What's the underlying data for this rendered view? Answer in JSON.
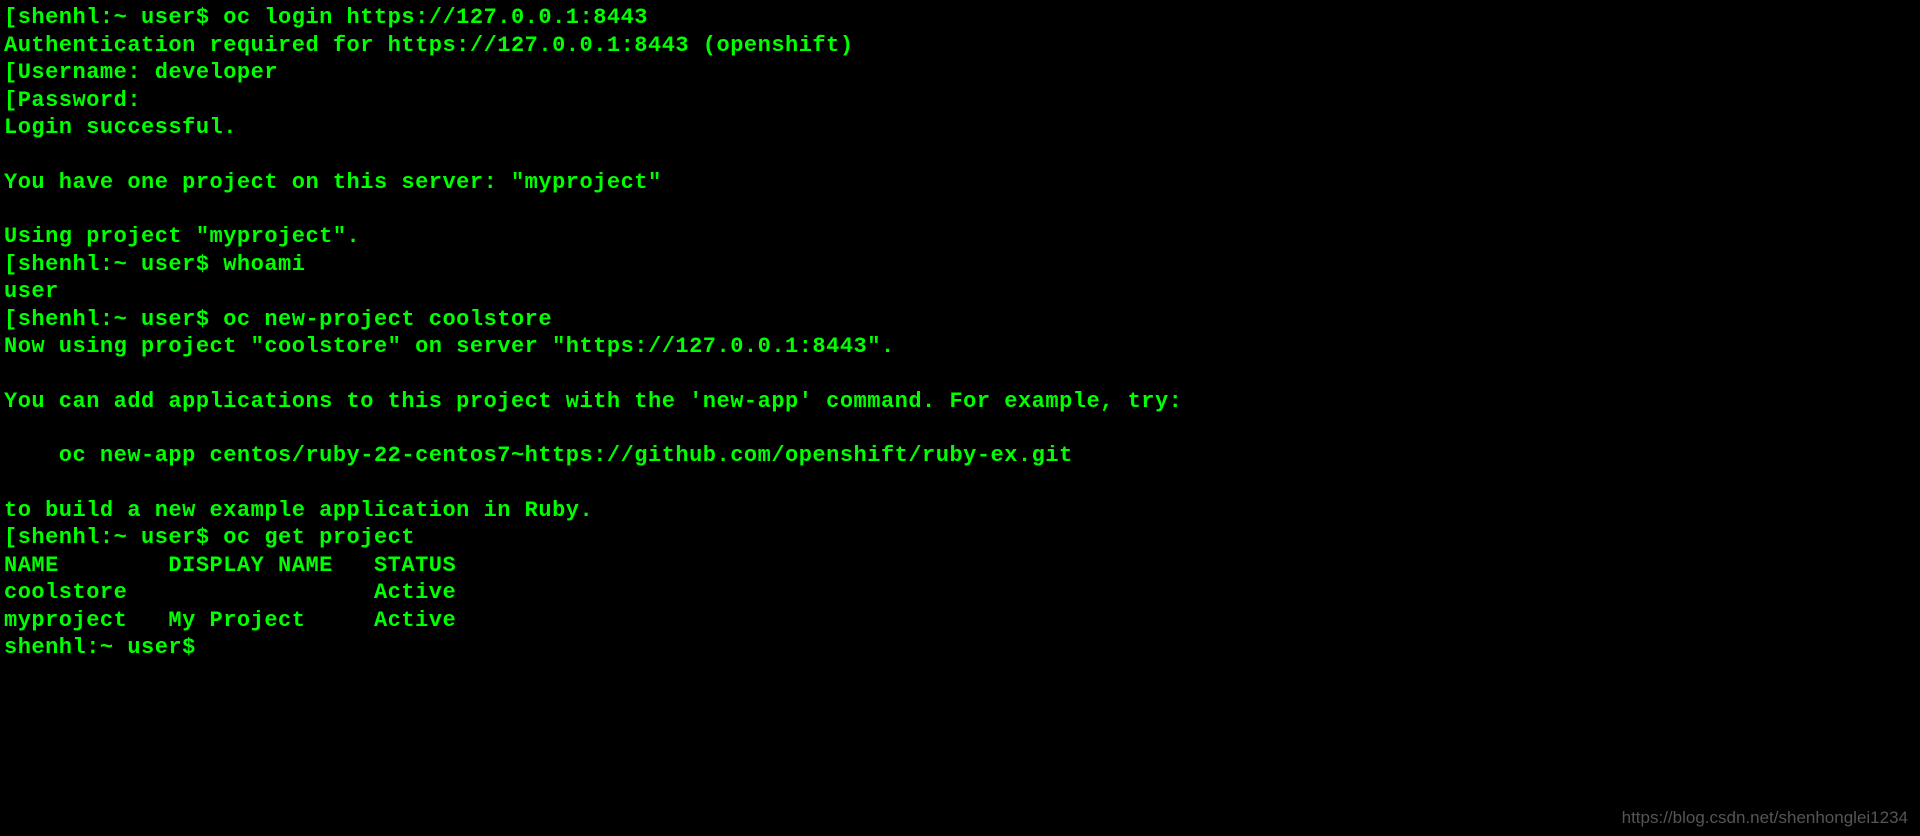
{
  "terminal": {
    "lines": [
      {
        "type": "prompt-cmd",
        "prompt": "shenhl:~ user$",
        "cmd": " oc login https://127.0.0.1:8443",
        "bracket": true
      },
      {
        "type": "output",
        "text": "Authentication required for https://127.0.0.1:8443 (openshift)"
      },
      {
        "type": "prompt-cmd",
        "prompt": "Username:",
        "cmd": " developer",
        "bracket": true
      },
      {
        "type": "prompt-cmd",
        "prompt": "Password:",
        "cmd": "",
        "bracket": true
      },
      {
        "type": "output",
        "text": "Login successful."
      },
      {
        "type": "blank"
      },
      {
        "type": "output",
        "text": "You have one project on this server: \"myproject\""
      },
      {
        "type": "blank"
      },
      {
        "type": "output",
        "text": "Using project \"myproject\"."
      },
      {
        "type": "prompt-cmd",
        "prompt": "shenhl:~ user$",
        "cmd": " whoami",
        "bracket": true
      },
      {
        "type": "output",
        "text": "user"
      },
      {
        "type": "prompt-cmd",
        "prompt": "shenhl:~ user$",
        "cmd": " oc new-project coolstore",
        "bracket": true
      },
      {
        "type": "output",
        "text": "Now using project \"coolstore\" on server \"https://127.0.0.1:8443\"."
      },
      {
        "type": "blank"
      },
      {
        "type": "output",
        "text": "You can add applications to this project with the 'new-app' command. For example, try:"
      },
      {
        "type": "blank"
      },
      {
        "type": "output",
        "text": "    oc new-app centos/ruby-22-centos7~https://github.com/openshift/ruby-ex.git"
      },
      {
        "type": "blank"
      },
      {
        "type": "output",
        "text": "to build a new example application in Ruby."
      },
      {
        "type": "prompt-cmd",
        "prompt": "shenhl:~ user$",
        "cmd": " oc get project",
        "bracket": true
      },
      {
        "type": "output",
        "text": "NAME        DISPLAY NAME   STATUS"
      },
      {
        "type": "output",
        "text": "coolstore                  Active"
      },
      {
        "type": "output",
        "text": "myproject   My Project     Active"
      },
      {
        "type": "prompt-cmd",
        "prompt": "shenhl:~ user$",
        "cmd": "",
        "bracket": false
      }
    ]
  },
  "watermark": "https://blog.csdn.net/shenhonglei1234"
}
